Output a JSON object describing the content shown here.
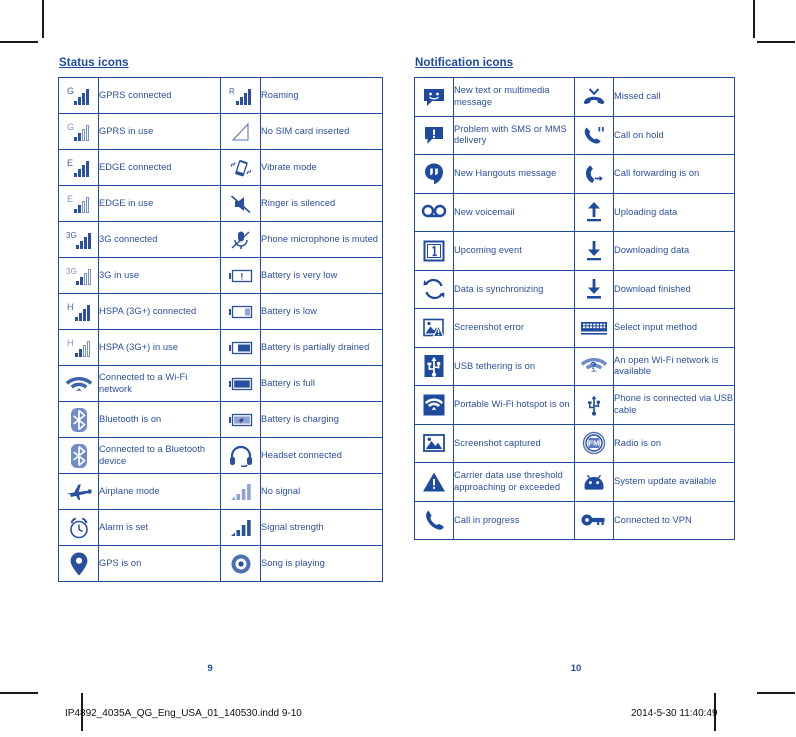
{
  "document": {
    "left_page_number": "9",
    "right_page_number": "10",
    "print_filename": "IP4892_4035A_QG_Eng_USA_01_140530.indd   9-10",
    "print_timestamp": "2014-5-30   11:40:49",
    "accent_color": "#1b4a9c",
    "text_color": "#2a4f9e",
    "border_color": "#234a9e"
  },
  "status_section": {
    "heading": "Status icons",
    "rows": [
      {
        "left_icon": "gprs-connected-icon",
        "left_label": "GPRS connected",
        "right_icon": "roaming-icon",
        "right_label": "Roaming"
      },
      {
        "left_icon": "gprs-in-use-icon",
        "left_label": "GPRS in use",
        "right_icon": "no-sim-card-icon",
        "right_label": "No SIM card inserted"
      },
      {
        "left_icon": "edge-connected-icon",
        "left_label": "EDGE connected",
        "right_icon": "vibrate-mode-icon",
        "right_label": "Vibrate mode"
      },
      {
        "left_icon": "edge-in-use-icon",
        "left_label": "EDGE in use",
        "right_icon": "ringer-silenced-icon",
        "right_label": "Ringer is silenced"
      },
      {
        "left_icon": "3g-connected-icon",
        "left_label": "3G connected",
        "right_icon": "microphone-muted-icon",
        "right_label": "Phone microphone is muted"
      },
      {
        "left_icon": "3g-in-use-icon",
        "left_label": "3G in use",
        "right_icon": "battery-very-low-icon",
        "right_label": "Battery is very low"
      },
      {
        "left_icon": "hspa-connected-icon",
        "left_label": "HSPA (3G+) connected",
        "right_icon": "battery-low-icon",
        "right_label": "Battery is low"
      },
      {
        "left_icon": "hspa-in-use-icon",
        "left_label": "HSPA (3G+) in use",
        "right_icon": "battery-partially-drained-icon",
        "right_label": "Battery is partially drained"
      },
      {
        "left_icon": "wifi-connected-icon",
        "left_label": "Connected to a Wi-Fi network",
        "right_icon": "battery-full-icon",
        "right_label": "Battery is full"
      },
      {
        "left_icon": "bluetooth-on-icon",
        "left_label": "Bluetooth is on",
        "right_icon": "battery-charging-icon",
        "right_label": "Battery is charging"
      },
      {
        "left_icon": "bluetooth-connected-icon",
        "left_label": "Connected to a Bluetooth device",
        "right_icon": "headset-connected-icon",
        "right_label": "Headset connected"
      },
      {
        "left_icon": "airplane-mode-icon",
        "left_label": "Airplane mode",
        "right_icon": "no-signal-icon",
        "right_label": "No signal"
      },
      {
        "left_icon": "alarm-set-icon",
        "left_label": "Alarm is set",
        "right_icon": "signal-strength-icon",
        "right_label": "Signal strength"
      },
      {
        "left_icon": "gps-on-icon",
        "left_label": "GPS is on",
        "right_icon": "song-playing-icon",
        "right_label": "Song is playing"
      }
    ]
  },
  "notification_section": {
    "heading": "Notification icons",
    "rows": [
      {
        "left_icon": "new-message-icon",
        "left_label": "New text or multimedia message",
        "right_icon": "missed-call-icon",
        "right_label": "Missed call"
      },
      {
        "left_icon": "message-problem-icon",
        "left_label": "Problem with SMS or MMS delivery",
        "right_icon": "call-on-hold-icon",
        "right_label": "Call on hold"
      },
      {
        "left_icon": "hangouts-message-icon",
        "left_label": "New Hangouts message",
        "right_icon": "call-forwarding-icon",
        "right_label": "Call forwarding is on"
      },
      {
        "left_icon": "voicemail-icon",
        "left_label": "New voicemail",
        "right_icon": "uploading-data-icon",
        "right_label": "Uploading data"
      },
      {
        "left_icon": "upcoming-event-icon",
        "left_label": "Upcoming event",
        "right_icon": "downloading-data-icon",
        "right_label": "Downloading data"
      },
      {
        "left_icon": "data-sync-icon",
        "left_label": "Data is synchronizing",
        "right_icon": "download-finished-icon",
        "right_label": "Download finished"
      },
      {
        "left_icon": "screenshot-error-icon",
        "left_label": "Screenshot error",
        "right_icon": "select-input-method-icon",
        "right_label": "Select input method"
      },
      {
        "left_icon": "usb-tethering-icon",
        "left_label": "USB tethering is on",
        "right_icon": "open-wifi-available-icon",
        "right_label": "An open Wi-Fi network is available"
      },
      {
        "left_icon": "portable-hotspot-icon",
        "left_label": "Portable Wi-Fi hotspot is on",
        "right_icon": "usb-connected-icon",
        "right_label": "Phone is connected via USB cable"
      },
      {
        "left_icon": "screenshot-captured-icon",
        "left_label": "Screenshot captured",
        "right_icon": "radio-on-icon",
        "right_label": "Radio is on"
      },
      {
        "left_icon": "data-warning-icon",
        "left_label": "Carrier data use threshold approaching or exceeded",
        "right_icon": "system-update-icon",
        "right_label": "System update available"
      },
      {
        "left_icon": "call-in-progress-icon",
        "left_label": "Call in progress",
        "right_icon": "vpn-connected-icon",
        "right_label": "Connected to VPN"
      }
    ]
  }
}
